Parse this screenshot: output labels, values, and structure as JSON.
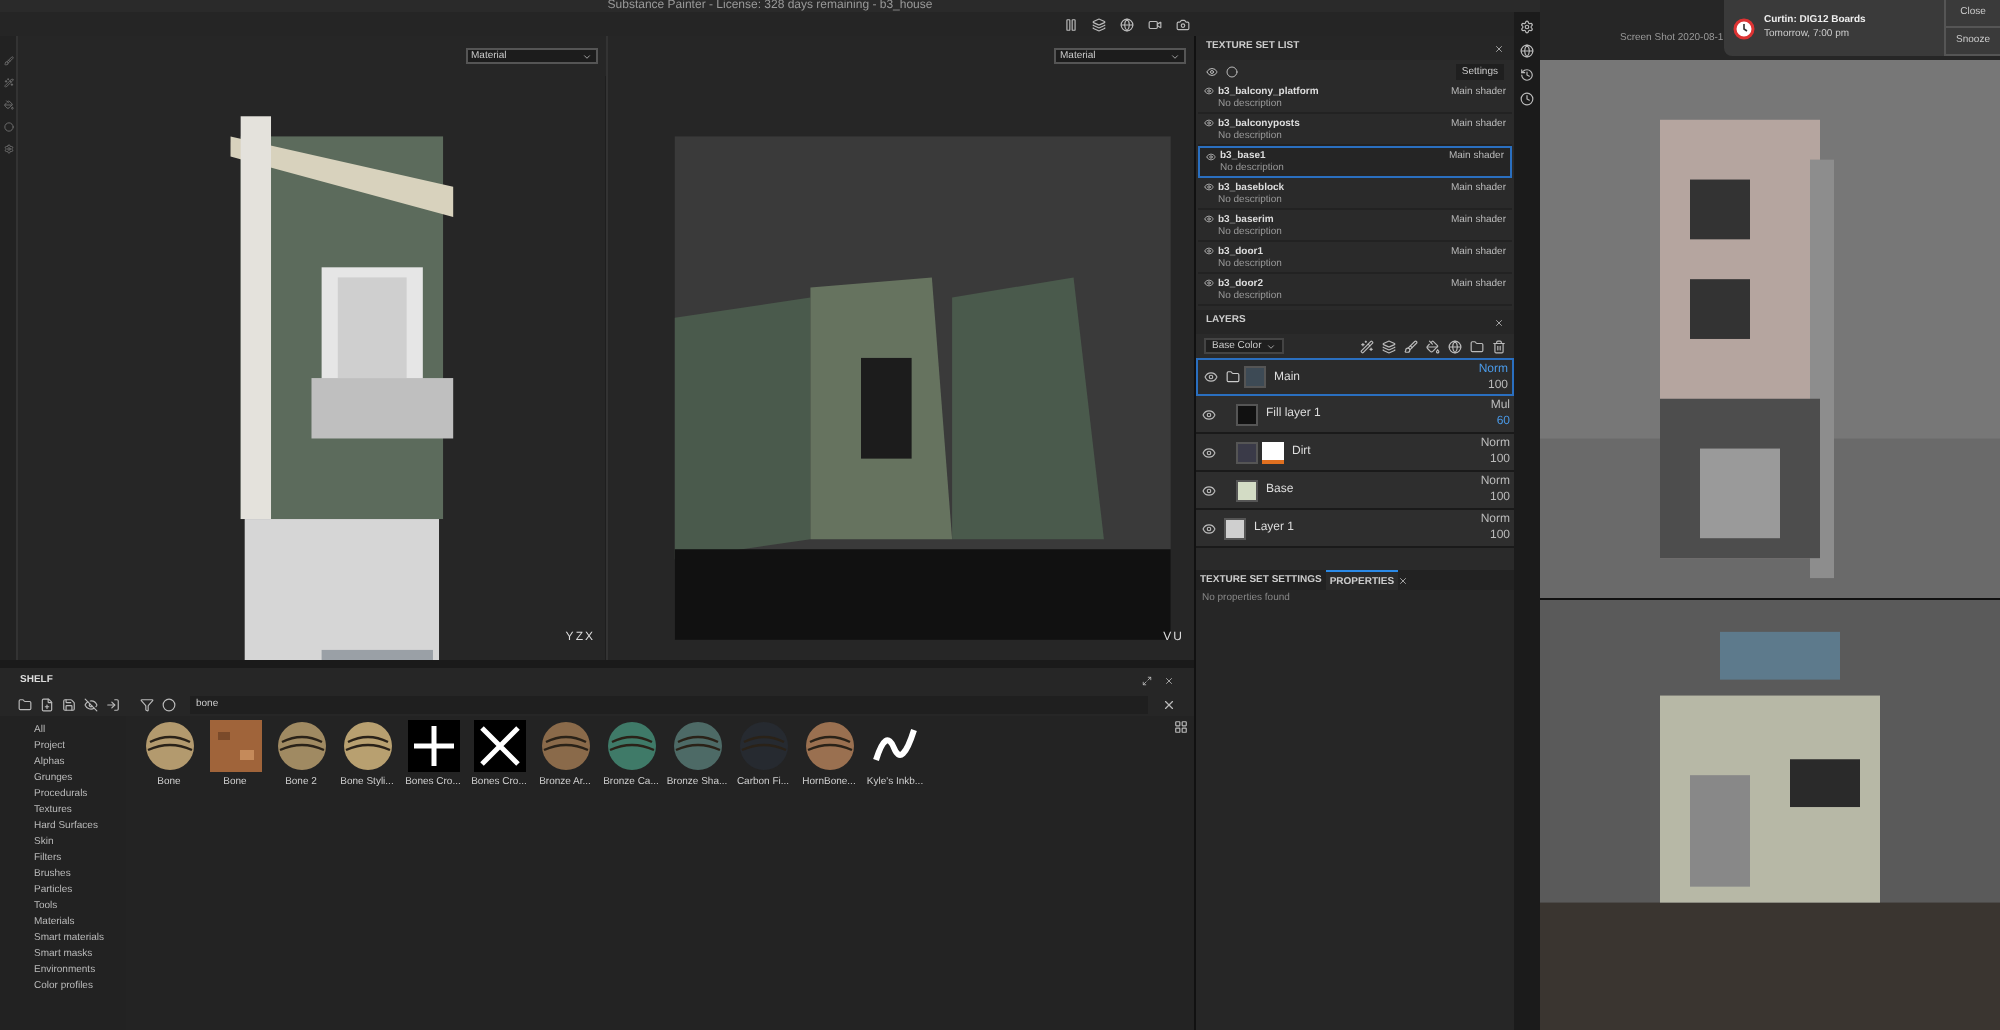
{
  "window": {
    "title": "Substance Painter - License: 328 days remaining - b3_house"
  },
  "viewports": [
    {
      "material": "Material",
      "kind": "model",
      "gizmo": [
        "Y",
        "Z",
        "X"
      ]
    },
    {
      "material": "Material",
      "kind": "uv",
      "gizmo": [
        "V",
        "U"
      ]
    }
  ],
  "texture_set_list": {
    "title": "TEXTURE SET LIST",
    "settings": "Settings",
    "items": [
      {
        "name": "b3_balcony_platform",
        "shader": "Main shader",
        "description": "No description",
        "selected": false
      },
      {
        "name": "b3_balconyposts",
        "shader": "Main shader",
        "description": "No description",
        "selected": false
      },
      {
        "name": "b3_base1",
        "shader": "Main shader",
        "description": "No description",
        "selected": true
      },
      {
        "name": "b3_baseblock",
        "shader": "Main shader",
        "description": "No description",
        "selected": false
      },
      {
        "name": "b3_baserim",
        "shader": "Main shader",
        "description": "No description",
        "selected": false
      },
      {
        "name": "b3_door1",
        "shader": "Main shader",
        "description": "No description",
        "selected": false
      },
      {
        "name": "b3_door2",
        "shader": "Main shader",
        "description": "No description",
        "selected": false
      }
    ]
  },
  "layers": {
    "title": "LAYERS",
    "channel": "Base Color",
    "items": [
      {
        "name": "Main",
        "kind": "group",
        "blend": "Norm",
        "opacity": "100",
        "blend_modified": true,
        "opacity_modified": false,
        "selected": true,
        "children": [
          {
            "name": "Fill layer 1",
            "kind": "fill",
            "blend": "Mul",
            "opacity": "60",
            "blend_modified": false,
            "opacity_modified": true,
            "selected": false
          },
          {
            "name": "Dirt",
            "kind": "masked",
            "blend": "Norm",
            "opacity": "100",
            "blend_modified": false,
            "opacity_modified": false,
            "selected": false
          },
          {
            "name": "Base",
            "kind": "paint",
            "blend": "Norm",
            "opacity": "100",
            "blend_modified": false,
            "opacity_modified": false,
            "selected": false
          }
        ]
      },
      {
        "name": "Layer 1",
        "kind": "empty",
        "blend": "Norm",
        "opacity": "100",
        "blend_modified": false,
        "opacity_modified": false,
        "selected": false
      }
    ]
  },
  "properties": {
    "tabs": [
      {
        "label": "TEXTURE SET SETTINGS",
        "selected": false
      },
      {
        "label": "PROPERTIES",
        "selected": true
      }
    ],
    "message": "No properties found"
  },
  "shelf": {
    "title": "SHELF",
    "search": "bone",
    "categories": [
      "All",
      "Project",
      "Alphas",
      "Grunges",
      "Procedurals",
      "Textures",
      "Hard Surfaces",
      "Skin",
      "Filters",
      "Brushes",
      "Particles",
      "Tools",
      "Materials",
      "Smart materials",
      "Smart masks",
      "Environments",
      "Color profiles"
    ],
    "items": [
      {
        "label": "Bone",
        "kind": "sphere",
        "color": "#b39a6e"
      },
      {
        "label": "Bone",
        "kind": "texture",
        "color": "#a0643a"
      },
      {
        "label": "Bone 2",
        "kind": "sphere",
        "color": "#a08a62"
      },
      {
        "label": "Bone Styli...",
        "kind": "sphere",
        "color": "#b8a070"
      },
      {
        "label": "Bones Cro...",
        "kind": "cross"
      },
      {
        "label": "Bones Cro...",
        "kind": "bones"
      },
      {
        "label": "Bronze Ar...",
        "kind": "sphere",
        "color": "#8a6a4a"
      },
      {
        "label": "Bronze Ca...",
        "kind": "sphere",
        "color": "#3f7a68"
      },
      {
        "label": "Bronze Sha...",
        "kind": "sphere",
        "color": "#4d6a66"
      },
      {
        "label": "Carbon Fi...",
        "kind": "sphere",
        "color": "#262a30"
      },
      {
        "label": "HornBone...",
        "kind": "sphere",
        "color": "#9a7050"
      },
      {
        "label": "Kyle's Inkb...",
        "kind": "curve"
      }
    ]
  },
  "viewer": {
    "file": "Screen Shot 2020-08-1"
  },
  "notification": {
    "title": "Curtin: DIG12 Boards",
    "time": "Tomorrow, 7:00 pm",
    "buttons": [
      "Close",
      "Snooze"
    ]
  }
}
